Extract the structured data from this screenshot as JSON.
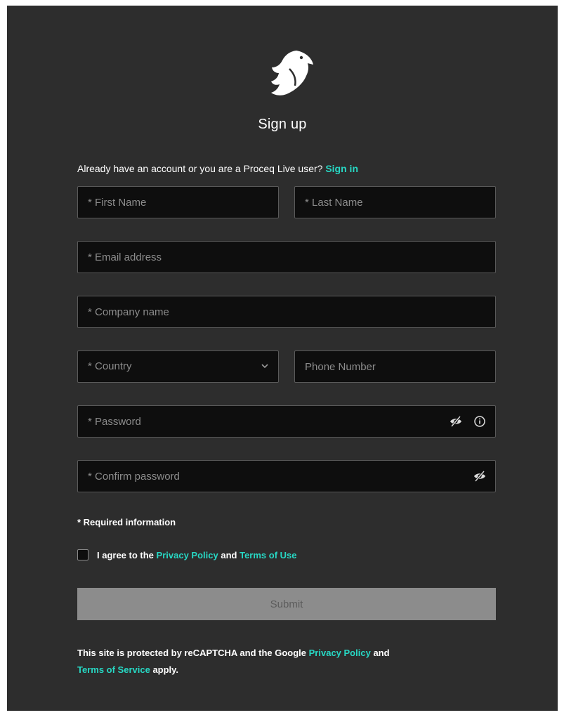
{
  "header": {
    "title": "Sign up"
  },
  "signin_prompt": {
    "text": "Already have an account or you are a Proceq Live user?",
    "link": "Sign in"
  },
  "fields": {
    "first_name": {
      "placeholder": "* First Name",
      "value": ""
    },
    "last_name": {
      "placeholder": "* Last Name",
      "value": ""
    },
    "email": {
      "placeholder": "* Email address",
      "value": ""
    },
    "company": {
      "placeholder": "* Company name",
      "value": ""
    },
    "country": {
      "selected": "* Country"
    },
    "phone": {
      "placeholder": "Phone Number",
      "value": ""
    },
    "password": {
      "placeholder": "* Password",
      "value": ""
    },
    "confirm_password": {
      "placeholder": "* Confirm password",
      "value": ""
    }
  },
  "required_note": "* Required information",
  "agree": {
    "prefix": "I agree to the",
    "privacy_link": "Privacy Policy",
    "and": "and",
    "terms_link": "Terms of Use",
    "checked": false
  },
  "submit_label": "Submit",
  "recaptcha": {
    "prefix": "This site is protected by reCAPTCHA and the Google",
    "privacy_link": "Privacy Policy",
    "and": "and",
    "terms_link": "Terms of Service",
    "suffix": "apply."
  },
  "icons": [
    "eagle-logo-icon",
    "chevron-down-icon",
    "eye-slash-icon",
    "info-icon"
  ],
  "colors": {
    "background": "#2d2d2d",
    "field": "#0e0e0e",
    "accent": "#27d8c4",
    "submit": "#8c8c8c"
  }
}
